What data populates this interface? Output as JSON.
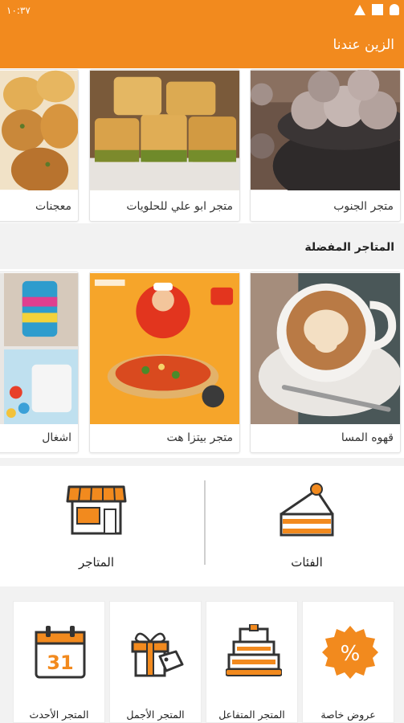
{
  "status_bar": {
    "time": "١٠:٣٧"
  },
  "app_bar": {
    "title": "الزين عندنا"
  },
  "top_stores": [
    {
      "label": "متجر الجنوب"
    },
    {
      "label": "متجر ابو علي للحلويات"
    },
    {
      "label": "معجنات"
    }
  ],
  "favorites": {
    "title": "المتاجر المفضلة",
    "items": [
      {
        "label": "قهوه المسا"
      },
      {
        "label": "متجر بيتزا هت"
      },
      {
        "label": "اشغال"
      }
    ]
  },
  "panel": {
    "categories_label": "الفئات",
    "stores_label": "المتاجر"
  },
  "tiles": [
    {
      "label": "عروض خاصة"
    },
    {
      "label": "المتجر المتفاعل"
    },
    {
      "label": "المتجر الأجمل"
    },
    {
      "label": "المتجر الأحدث"
    }
  ],
  "calendar_day": "31",
  "percent_symbol": "%",
  "colors": {
    "accent": "#f28a1e"
  }
}
